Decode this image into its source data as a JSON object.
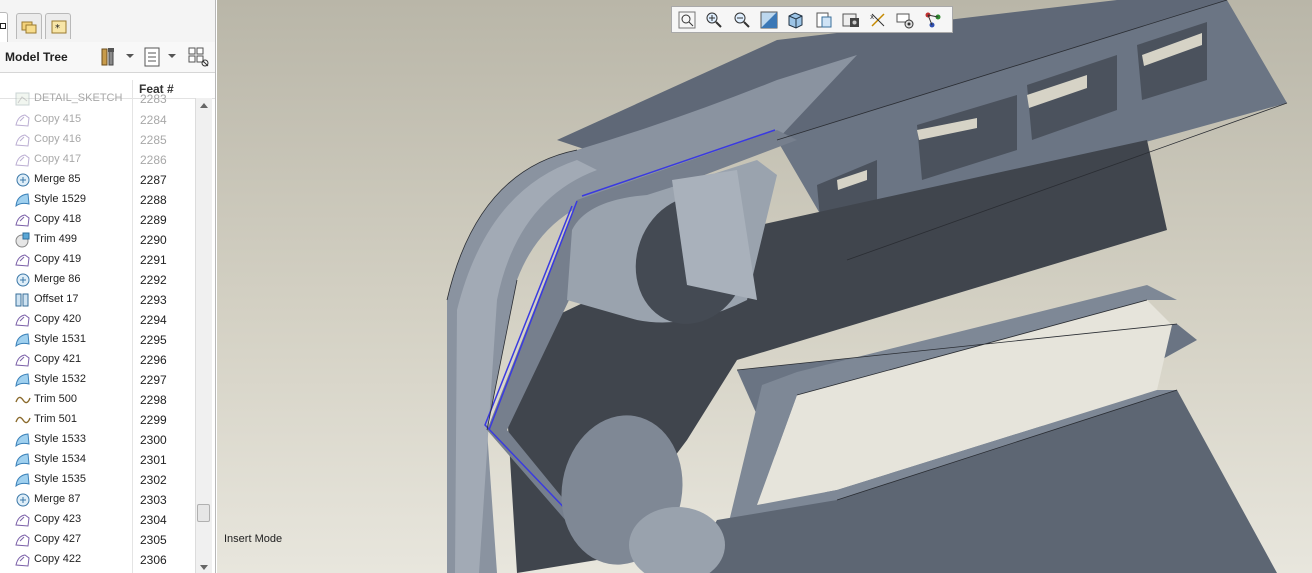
{
  "window": {
    "status_text": "Insert Mode"
  },
  "tabs": [
    {
      "icon": "model-tree-tab-icon"
    },
    {
      "icon": "folder-browser-icon"
    },
    {
      "icon": "favorites-icon"
    }
  ],
  "model_tree": {
    "title": "Model Tree",
    "toolbar_icons": [
      "tree-settings-icon",
      "show-list-icon",
      "column-filter-icon"
    ],
    "column_header": "Feat #",
    "rows": [
      {
        "label": "DETAIL_SKETCH",
        "num": "2283",
        "icon": "sketch-icon",
        "dim": true
      },
      {
        "label": "Copy 415",
        "num": "2284",
        "icon": "copy-icon",
        "dim": true
      },
      {
        "label": "Copy 416",
        "num": "2285",
        "icon": "copy-icon",
        "dim": true
      },
      {
        "label": "Copy 417",
        "num": "2286",
        "icon": "copy-icon",
        "dim": true
      },
      {
        "label": "Merge 85",
        "num": "2287",
        "icon": "merge-icon",
        "dim": false
      },
      {
        "label": "Style 1529",
        "num": "2288",
        "icon": "style-icon",
        "dim": false
      },
      {
        "label": "Copy 418",
        "num": "2289",
        "icon": "copy-icon",
        "dim": false
      },
      {
        "label": "Trim 499",
        "num": "2290",
        "icon": "trim-surface-icon",
        "dim": false
      },
      {
        "label": "Copy 419",
        "num": "2291",
        "icon": "copy-icon",
        "dim": false
      },
      {
        "label": "Merge 86",
        "num": "2292",
        "icon": "merge-icon",
        "dim": false
      },
      {
        "label": "Offset 17",
        "num": "2293",
        "icon": "offset-icon",
        "dim": false
      },
      {
        "label": "Copy 420",
        "num": "2294",
        "icon": "copy-icon",
        "dim": false
      },
      {
        "label": "Style 1531",
        "num": "2295",
        "icon": "style-icon",
        "dim": false
      },
      {
        "label": "Copy 421",
        "num": "2296",
        "icon": "copy-icon",
        "dim": false
      },
      {
        "label": "Style 1532",
        "num": "2297",
        "icon": "style-icon",
        "dim": false
      },
      {
        "label": "Trim 500",
        "num": "2298",
        "icon": "trim-curve-icon",
        "dim": false
      },
      {
        "label": "Trim 501",
        "num": "2299",
        "icon": "trim-curve-icon",
        "dim": false
      },
      {
        "label": "Style 1533",
        "num": "2300",
        "icon": "style-icon",
        "dim": false
      },
      {
        "label": "Style 1534",
        "num": "2301",
        "icon": "style-icon",
        "dim": false
      },
      {
        "label": "Style 1535",
        "num": "2302",
        "icon": "style-icon",
        "dim": false
      },
      {
        "label": "Merge 87",
        "num": "2303",
        "icon": "merge-icon",
        "dim": false
      },
      {
        "label": "Copy 423",
        "num": "2304",
        "icon": "copy-icon",
        "dim": false
      },
      {
        "label": "Copy 427",
        "num": "2305",
        "icon": "copy-icon",
        "dim": false
      },
      {
        "label": "Copy 422",
        "num": "2306",
        "icon": "copy-icon",
        "dim": false
      }
    ]
  },
  "view_toolbar": [
    {
      "name": "refit-icon"
    },
    {
      "name": "zoom-in-icon"
    },
    {
      "name": "zoom-out-icon"
    },
    {
      "name": "repaint-icon"
    },
    {
      "name": "display-style-icon"
    },
    {
      "name": "saved-views-icon"
    },
    {
      "name": "view-manager-icon"
    },
    {
      "name": "datum-display-icon"
    },
    {
      "name": "annotation-display-icon"
    },
    {
      "name": "spin-center-icon"
    }
  ],
  "colors": {
    "model_gray": "#6e7887",
    "model_dark": "#3f444c",
    "selection_edge": "#3a3ae0",
    "background_top": "#b9b6a8",
    "background_bottom": "#e8e6dd"
  }
}
